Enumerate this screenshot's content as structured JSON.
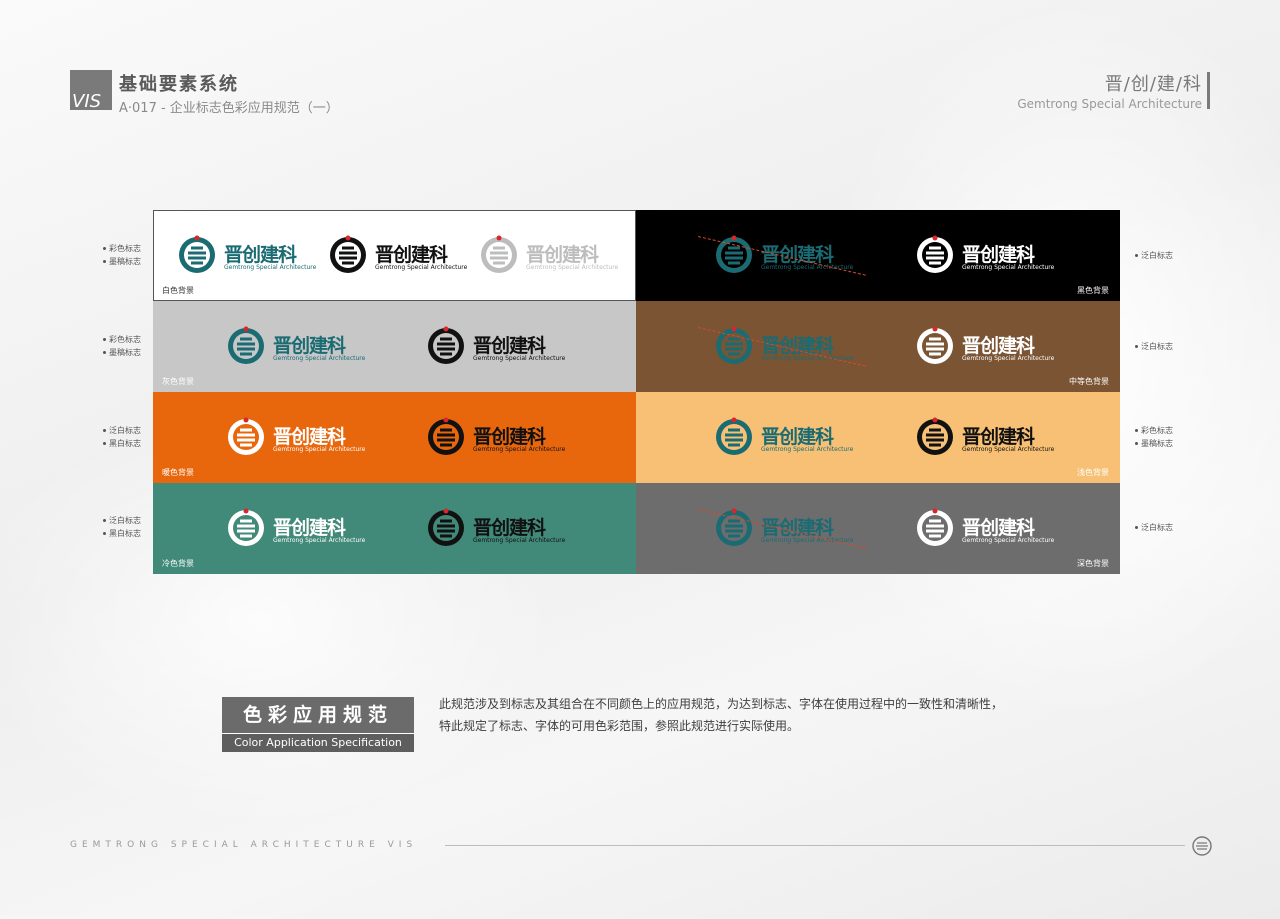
{
  "header": {
    "vis_mark": "VIS",
    "title": "基础要素系统",
    "subtitle": "A·017 - 企业标志色彩应用规范（一）",
    "brand_cn": "晋/创/建/科",
    "brand_en": "Gemtrong Special Architecture"
  },
  "logo": {
    "wordmark": "晋创建科",
    "english": "Gemtrong Special Architecture"
  },
  "panels": [
    {
      "label": "白色背景",
      "bg": "#ffffff",
      "label_color": "#333333",
      "label_side": "left",
      "logos": [
        {
          "variant": "color",
          "icon": "#1b6b73",
          "text": "#1b6b73"
        },
        {
          "variant": "black",
          "icon": "#111111",
          "text": "#111111"
        },
        {
          "variant": "grey",
          "icon": "#bdbdbd",
          "text": "#bdbdbd"
        }
      ]
    },
    {
      "label": "黑色背景",
      "bg": "#000000",
      "label_color": "#ffffff",
      "label_side": "right",
      "logos": [
        {
          "variant": "color-invalid",
          "icon": "#1b6b73",
          "text": "#1b6b73",
          "struck": true
        },
        {
          "variant": "white",
          "icon": "#ffffff",
          "text": "#ffffff"
        }
      ]
    },
    {
      "label": "灰色背景",
      "bg": "#c7c7c7",
      "label_color": "#ffffff",
      "label_side": "left",
      "logos": [
        {
          "variant": "color",
          "icon": "#1b6b73",
          "text": "#1b6b73"
        },
        {
          "variant": "black",
          "icon": "#111111",
          "text": "#111111"
        }
      ]
    },
    {
      "label": "中等色背景",
      "bg": "#7a5433",
      "label_color": "#ffffff",
      "label_side": "right",
      "logos": [
        {
          "variant": "color-invalid",
          "icon": "#1b6b73",
          "text": "#1b6b73",
          "struck": true
        },
        {
          "variant": "white",
          "icon": "#ffffff",
          "text": "#ffffff"
        }
      ]
    },
    {
      "label": "暖色背景",
      "bg": "#e8670d",
      "label_color": "#ffffff",
      "label_side": "left",
      "logos": [
        {
          "variant": "white",
          "icon": "#ffffff",
          "text": "#ffffff"
        },
        {
          "variant": "black",
          "icon": "#111111",
          "text": "#111111"
        }
      ]
    },
    {
      "label": "浅色背景",
      "bg": "#f7c074",
      "label_color": "#ffffff",
      "label_side": "right",
      "logos": [
        {
          "variant": "color",
          "icon": "#1b6b73",
          "text": "#1b6b73"
        },
        {
          "variant": "black",
          "icon": "#111111",
          "text": "#111111"
        }
      ]
    },
    {
      "label": "冷色背景",
      "bg": "#418979",
      "label_color": "#ffffff",
      "label_side": "left",
      "logos": [
        {
          "variant": "white",
          "icon": "#ffffff",
          "text": "#ffffff"
        },
        {
          "variant": "black",
          "icon": "#111111",
          "text": "#111111"
        }
      ]
    },
    {
      "label": "深色背景",
      "bg": "#6e6d6d",
      "label_color": "#ffffff",
      "label_side": "right",
      "logos": [
        {
          "variant": "color-invalid",
          "icon": "#1b6b73",
          "text": "#1b6b73",
          "struck": true
        },
        {
          "variant": "white",
          "icon": "#ffffff",
          "text": "#ffffff"
        }
      ]
    }
  ],
  "annotations": {
    "left": [
      [
        "彩色标志",
        "墨稿标志"
      ],
      [
        "彩色标志",
        "墨稿标志"
      ],
      [
        "泛白标志",
        "黑白标志"
      ],
      [
        "泛白标志",
        "黑白标志"
      ]
    ],
    "right": [
      [
        "泛白标志"
      ],
      [
        "泛白标志"
      ],
      [
        "彩色标志",
        "墨稿标志"
      ],
      [
        "泛白标志"
      ]
    ]
  },
  "spec": {
    "title": "色彩应用规范",
    "subtitle": "Color Application Specification",
    "line1": "此规范涉及到标志及其组合在不同颜色上的应用规范，为达到标志、字体在使用过程中的一致性和清晰性，",
    "line2": "特此规定了标志、字体的可用色彩范围，参照此规范进行实际使用。"
  },
  "footer": {
    "text": "GEMTRONG SPECIAL ARCHITECTURE VIS"
  }
}
